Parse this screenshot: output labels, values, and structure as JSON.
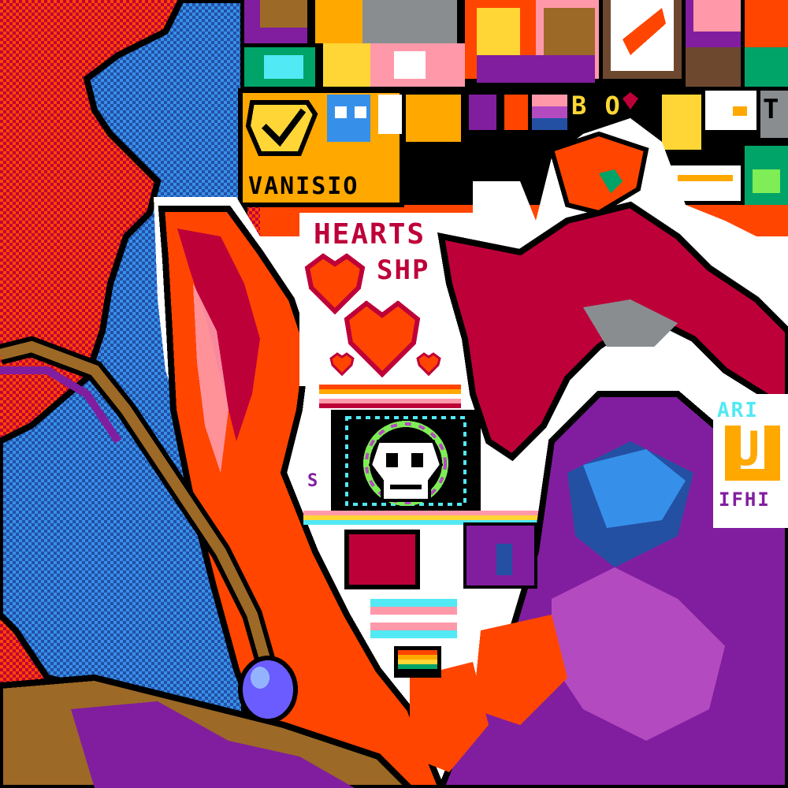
{
  "canvas": {
    "palette": {
      "red": "#ff4500",
      "dark_red": "#be0039",
      "orange": "#ffa800",
      "yellow": "#ffd635",
      "blue": "#3690ea",
      "dark_blue": "#2450a4",
      "light_blue": "#51e9f4",
      "purple": "#811e9f",
      "light_purple": "#b44ac0",
      "pink": "#ff99aa",
      "brown": "#9c6926",
      "dark_brown": "#6d482f",
      "black": "#000000",
      "white": "#ffffff",
      "gray": "#898d90",
      "green": "#00a368"
    },
    "texts": {
      "vanisio": "VANISIO",
      "hearts_line1": "HEARTS",
      "hearts_line2": "SHP",
      "ari": "ARI",
      "ari_letter": "U",
      "ari_sub": "IFHI",
      "b_o": "B O",
      "small_s": "S",
      "t_letter": "T"
    }
  }
}
